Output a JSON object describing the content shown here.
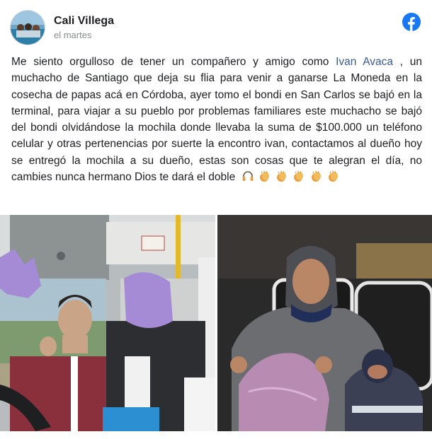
{
  "post": {
    "author": "Cali Villega",
    "timestamp": "el martes",
    "text_before": "Me siento orgulloso de tener un compañero y amigo como ",
    "mention": "Ivan Avaca",
    "text_after": " , un muchacho de Santiago que deja su flia para venir a ganarse La Moneda en la cosecha de papas acá en Córdoba, ayer tomo el bondi en San Carlos se bajó en la terminal, para viajar a su pueblo por problemas familiares este muchacho se bajó del bondi olvidándose la mochila donde llevaba la suma de $100.000 un teléfono celular y otras pertenencias por suerte la encontro ivan, contactamos al dueño hoy se entregó la mochila a su dueño, estas son cosas que te alegran el día, no cambies nunca hermano Dios te dará el doble",
    "emojis": [
      "headphones-emoji",
      "clapping-hands-emoji",
      "clapping-hands-emoji",
      "clapping-hands-emoji",
      "clapping-hands-emoji",
      "clapping-hands-emoji"
    ]
  },
  "icons": {
    "brand": "facebook-icon"
  },
  "colors": {
    "facebook_blue": "#1877f2",
    "mention": "#385898",
    "timestamp": "#8a8d91"
  },
  "photos": [
    {
      "name": "photo-bus-driver"
    },
    {
      "name": "photo-man-with-backpack"
    }
  ]
}
